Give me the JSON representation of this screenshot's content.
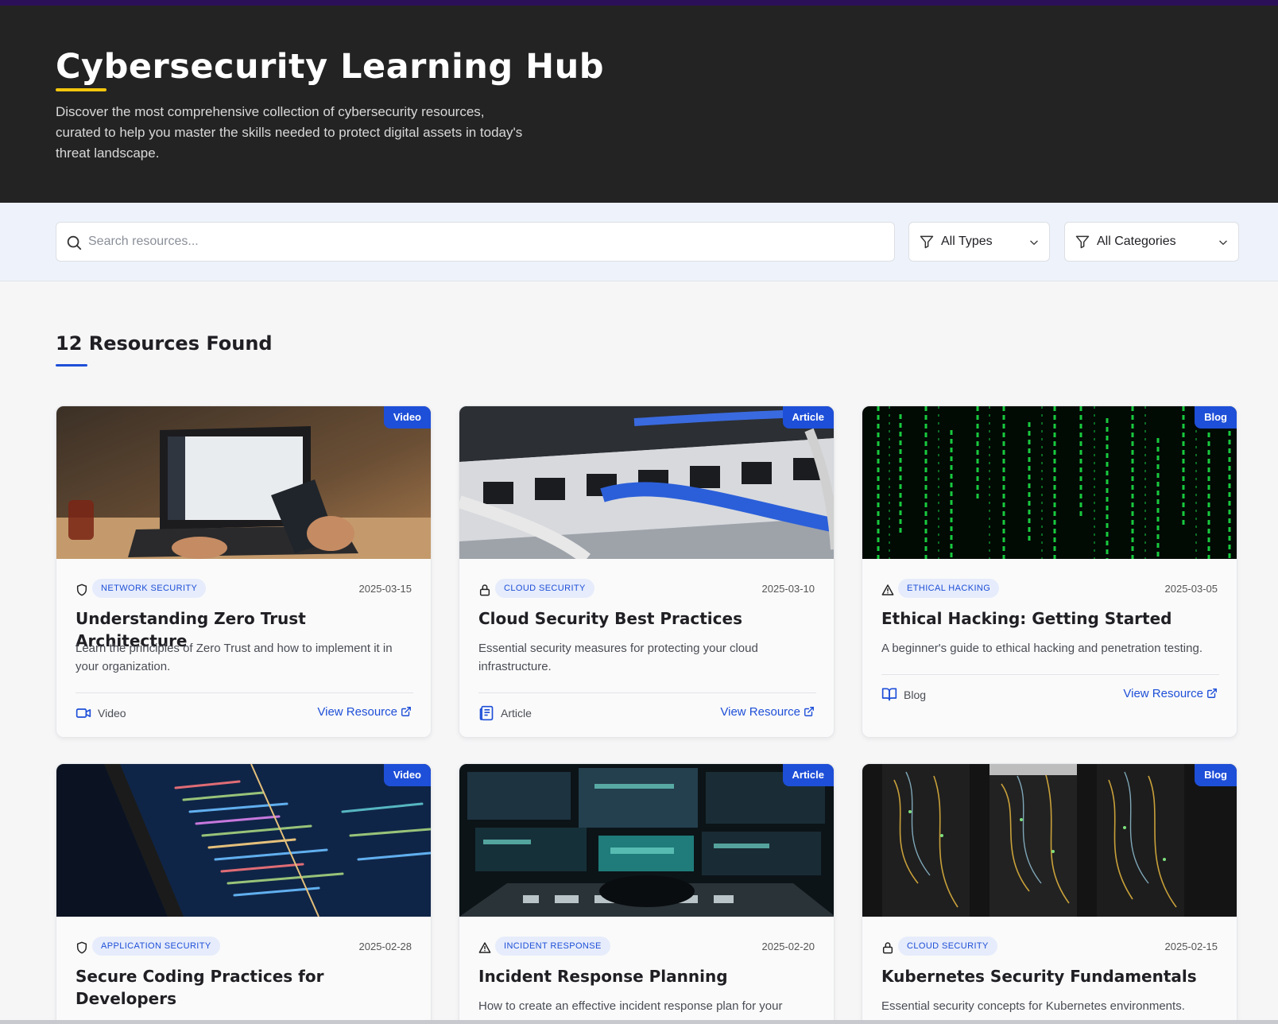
{
  "hero": {
    "title": "Cybersecurity Learning Hub",
    "description": "Discover the most comprehensive collection of cybersecurity resources, curated to help you master the skills needed to protect digital assets in today's threat landscape."
  },
  "filters": {
    "search_placeholder": "Search resources...",
    "type_select": "All Types",
    "category_select": "All Categories"
  },
  "results": {
    "title": "12 Resources Found"
  },
  "colors": {
    "accent": "#1e4fd8",
    "hero_bg": "#232323",
    "hero_underline": "#f3c60d"
  },
  "cards": [
    {
      "badge": "Video",
      "category": "NETWORK SECURITY",
      "category_icon": "shield-icon",
      "date": "2025-03-15",
      "title": "Understanding Zero Trust Architecture",
      "description": "Learn the principles of Zero Trust and how to implement it in your organization.",
      "type_label": "Video",
      "type_icon": "video-icon",
      "link": "View Resource"
    },
    {
      "badge": "Article",
      "category": "CLOUD SECURITY",
      "category_icon": "lock-icon",
      "date": "2025-03-10",
      "title": "Cloud Security Best Practices",
      "description": "Essential security measures for protecting your cloud infrastructure.",
      "type_label": "Article",
      "type_icon": "article-icon",
      "link": "View Resource"
    },
    {
      "badge": "Blog",
      "category": "ETHICAL HACKING",
      "category_icon": "warning-icon",
      "date": "2025-03-05",
      "title": "Ethical Hacking: Getting Started",
      "description": "A beginner's guide to ethical hacking and penetration testing.",
      "type_label": "Blog",
      "type_icon": "book-icon",
      "link": "View Resource"
    },
    {
      "badge": "Video",
      "category": "APPLICATION SECURITY",
      "category_icon": "shield-icon",
      "date": "2025-02-28",
      "title": "Secure Coding Practices for Developers"
    },
    {
      "badge": "Article",
      "category": "INCIDENT RESPONSE",
      "category_icon": "warning-icon",
      "date": "2025-02-20",
      "title": "Incident Response Planning",
      "description": "How to create an effective incident response plan for your"
    },
    {
      "badge": "Blog",
      "category": "CLOUD SECURITY",
      "category_icon": "lock-icon",
      "date": "2025-02-15",
      "title": "Kubernetes Security Fundamentals",
      "description": "Essential security concepts for Kubernetes environments."
    }
  ]
}
